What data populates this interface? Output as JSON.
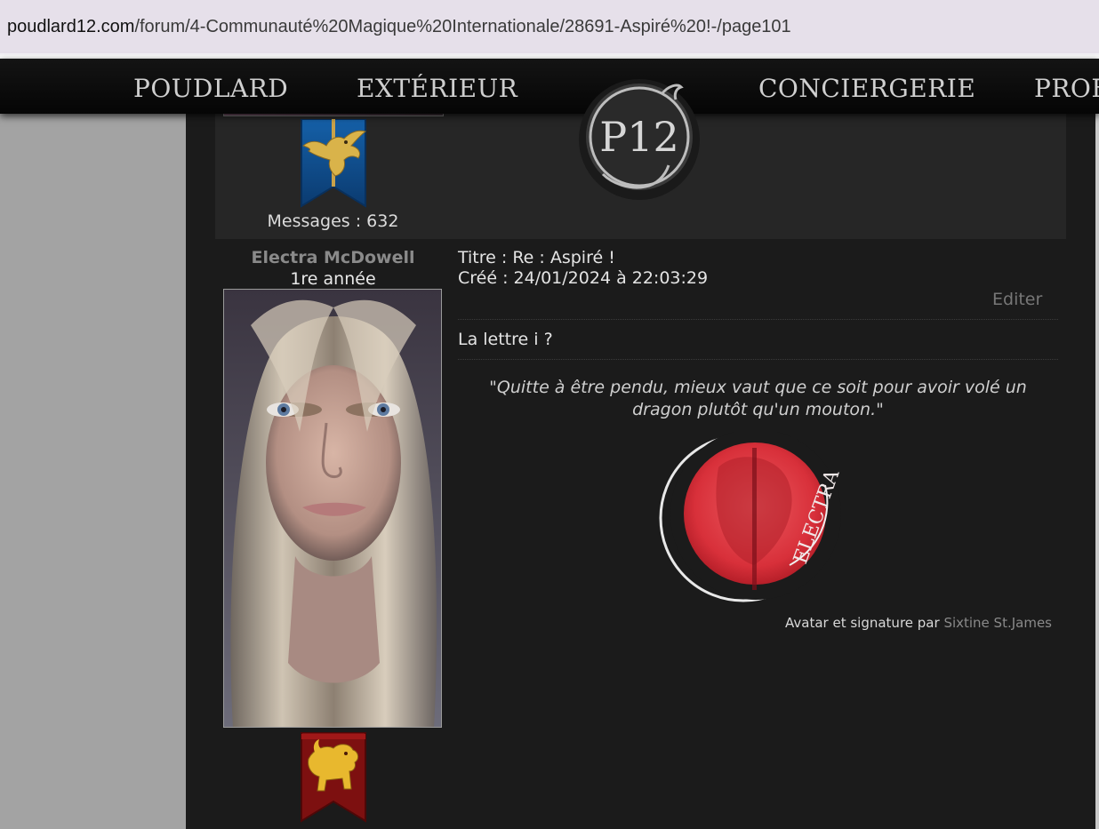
{
  "browser": {
    "url_domain": "poudlard12.com",
    "url_path": "/forum/4-Communauté%20Magique%20Internationale/28691-Aspiré%20!-/page101"
  },
  "nav": {
    "items": [
      {
        "label": "POUDLARD"
      },
      {
        "label": "EXTÉRIEUR"
      },
      {
        "label": "CONCIERGERIE"
      },
      {
        "label": "PROF"
      }
    ],
    "logo_text": "P12"
  },
  "previous_post": {
    "house": "ravenclaw-eagle-icon",
    "messages_label": "Messages : 632"
  },
  "post": {
    "author": "Electra McDowell",
    "rank": "1re année",
    "house": "gryffindor-lion-icon",
    "title": "Titre : Re : Aspiré !",
    "created": "Créé : 24/01/2024 à 22:03:29",
    "edit_label": "Editer",
    "body": "La lettre i ?",
    "signature_quote": "\"Quitte à être pendu, mieux vaut que ce soit pour avoir volé un dragon plutôt qu'un mouton.\"",
    "emblem_text": "ELECTRA",
    "credit_prefix": "Avatar et signature par ",
    "credit_artist": "Sixtine St.James"
  },
  "colors": {
    "ravenclaw_blue": "#0f4f8c",
    "gryffindor_red": "#7d1010",
    "gold": "#d9b34a",
    "emblem_red": "#d8303a"
  }
}
